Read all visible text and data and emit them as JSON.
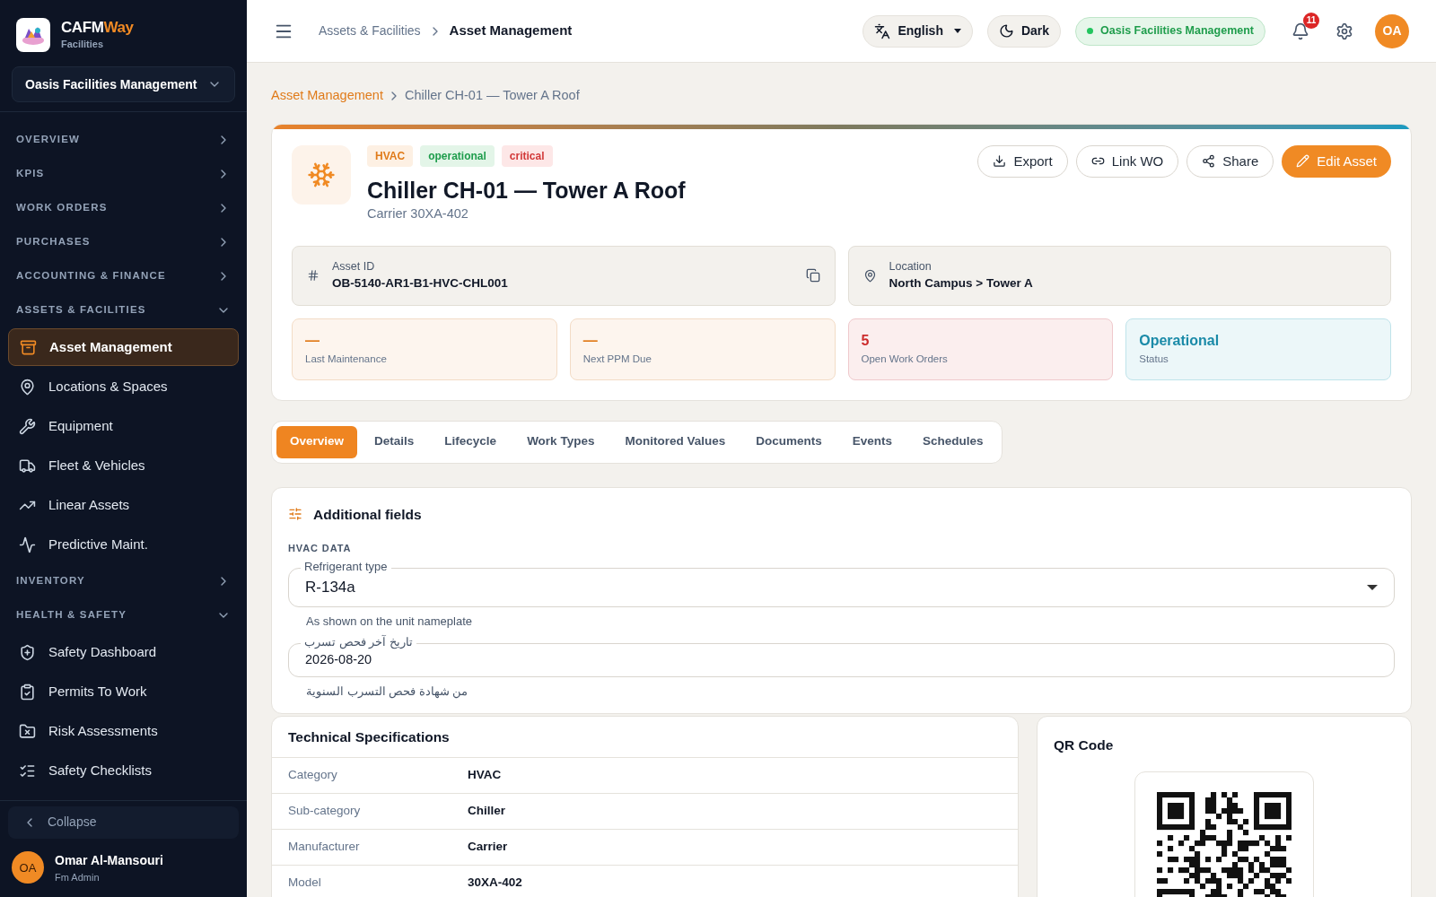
{
  "brand": {
    "name_start": "CAFM",
    "name_end": "Way",
    "subtitle": "Facilities"
  },
  "org_switcher": {
    "label": "Oasis Facilities Management"
  },
  "sidebar": {
    "items": [
      {
        "kind": "section",
        "label": "OVERVIEW",
        "expanded": false
      },
      {
        "kind": "section",
        "label": "KPIS",
        "expanded": false
      },
      {
        "kind": "section",
        "label": "WORK ORDERS",
        "expanded": false
      },
      {
        "kind": "section",
        "label": "PURCHASES",
        "expanded": false
      },
      {
        "kind": "section",
        "label": "ACCOUNTING & FINANCE",
        "expanded": false
      },
      {
        "kind": "section",
        "label": "ASSETS & FACILITIES",
        "expanded": true
      },
      {
        "kind": "item",
        "label": "Asset Management",
        "selected": true
      },
      {
        "kind": "item",
        "label": "Locations & Spaces",
        "selected": false
      },
      {
        "kind": "item",
        "label": "Equipment",
        "selected": false
      },
      {
        "kind": "item",
        "label": "Fleet & Vehicles",
        "selected": false
      },
      {
        "kind": "item",
        "label": "Linear Assets",
        "selected": false
      },
      {
        "kind": "item",
        "label": "Predictive Maint.",
        "selected": false
      },
      {
        "kind": "section",
        "label": "INVENTORY",
        "expanded": false
      },
      {
        "kind": "section",
        "label": "HEALTH & SAFETY",
        "expanded": true
      },
      {
        "kind": "item",
        "label": "Safety Dashboard",
        "selected": false
      },
      {
        "kind": "item",
        "label": "Permits To Work",
        "selected": false
      },
      {
        "kind": "item",
        "label": "Risk Assessments",
        "selected": false
      },
      {
        "kind": "item",
        "label": "Safety Checklists",
        "selected": false
      }
    ],
    "collapse": "Collapse",
    "user": {
      "initials": "OA",
      "name": "Omar Al-Mansouri",
      "role": "Fm Admin"
    }
  },
  "header": {
    "breadcrumb": [
      "Assets & Facilities",
      "Asset Management"
    ],
    "language": "English",
    "theme": "Dark",
    "org": "Oasis Facilities Management",
    "notifications": "11",
    "avatar": "OA"
  },
  "page_breadcrumb": [
    "Asset Management",
    "Chiller CH-01 — Tower A Roof"
  ],
  "asset": {
    "badges": [
      {
        "label": "HVAC",
        "kind": "category"
      },
      {
        "label": "operational",
        "kind": "success"
      },
      {
        "label": "critical",
        "kind": "danger"
      }
    ],
    "title": "Chiller CH-01 — Tower A Roof",
    "model": "Carrier 30XA-402",
    "actions": [
      {
        "label": "Export",
        "kind": "outline"
      },
      {
        "label": "Link WO",
        "kind": "outline"
      },
      {
        "label": "Share",
        "kind": "outline"
      },
      {
        "label": "Edit Asset",
        "kind": "primary"
      }
    ],
    "asset_id": {
      "label": "Asset ID",
      "value": "OB-5140-AR1-B1-HVC-CHL001"
    },
    "location": {
      "label": "Location",
      "value": "North Campus > Tower A"
    },
    "stats": [
      {
        "value": "—",
        "label": "Last Maintenance",
        "kind": "warning"
      },
      {
        "value": "—",
        "label": "Next PPM Due",
        "kind": "warning"
      },
      {
        "value": "5",
        "label": "Open Work Orders",
        "kind": "danger"
      },
      {
        "value": "Operational",
        "label": "Status",
        "kind": "info"
      }
    ]
  },
  "tabs": [
    {
      "label": "Overview",
      "selected": true
    },
    {
      "label": "Details",
      "selected": false
    },
    {
      "label": "Lifecycle",
      "selected": false
    },
    {
      "label": "Work Types",
      "selected": false
    },
    {
      "label": "Monitored Values",
      "selected": false
    },
    {
      "label": "Documents",
      "selected": false
    },
    {
      "label": "Events",
      "selected": false
    },
    {
      "label": "Schedules",
      "selected": false
    }
  ],
  "additional_fields": {
    "title": "Additional fields",
    "group": "HVAC DATA",
    "fields": [
      {
        "kind": "select",
        "label": "Refrigerant type",
        "value": "R-134a",
        "help": "As shown on the unit nameplate"
      },
      {
        "kind": "text",
        "label": "تاريخ آخر فحص تسرب",
        "value": "2026-08-20",
        "help": "من شهادة فحص التسرب السنوية"
      }
    ]
  },
  "tech_specs": {
    "title": "Technical Specifications",
    "rows": [
      {
        "label": "Category",
        "value": "HVAC"
      },
      {
        "label": "Sub-category",
        "value": "Chiller"
      },
      {
        "label": "Manufacturer",
        "value": "Carrier"
      },
      {
        "label": "Model",
        "value": "30XA-402"
      }
    ]
  },
  "qr": {
    "title": "QR Code"
  }
}
